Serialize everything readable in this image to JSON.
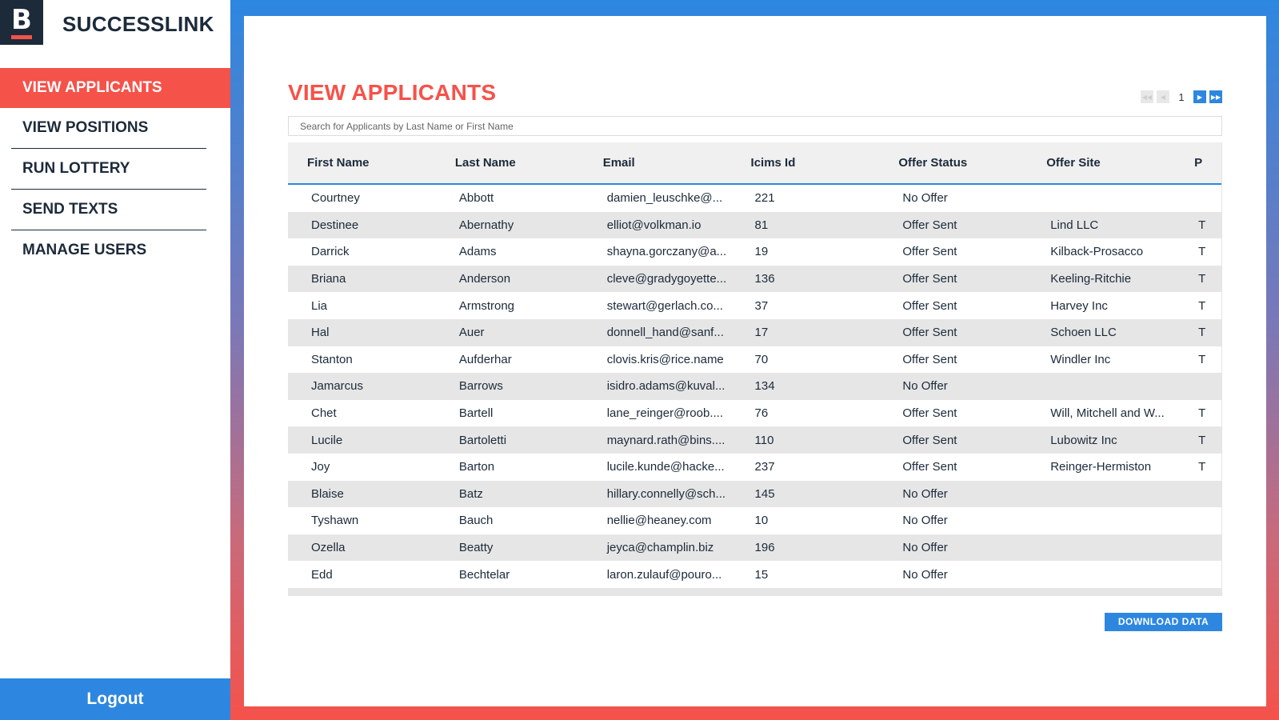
{
  "brand": {
    "logo_letter": "B",
    "name": "SUCCESSLINK"
  },
  "sidebar": {
    "items": [
      {
        "label": "VIEW APPLICANTS",
        "active": true
      },
      {
        "label": "VIEW POSITIONS"
      },
      {
        "label": "RUN LOTTERY"
      },
      {
        "label": "SEND TEXTS"
      },
      {
        "label": "MANAGE USERS"
      }
    ],
    "logout_label": "Logout"
  },
  "main": {
    "title": "VIEW APPLICANTS",
    "pager": {
      "current_page": "1"
    },
    "search": {
      "placeholder": "Search for Applicants by Last Name or First Name",
      "value": ""
    },
    "columns": [
      "First Name",
      "Last Name",
      "Email",
      "Icims Id",
      "Offer Status",
      "Offer Site",
      "P"
    ],
    "rows": [
      [
        "Courtney",
        "Abbott",
        "damien_leuschke@...",
        "221",
        "No Offer",
        "",
        ""
      ],
      [
        "Destinee",
        "Abernathy",
        "elliot@volkman.io",
        "81",
        "Offer Sent",
        "Lind LLC",
        "T"
      ],
      [
        "Darrick",
        "Adams",
        "shayna.gorczany@a...",
        "19",
        "Offer Sent",
        "Kilback-Prosacco",
        "T"
      ],
      [
        "Briana",
        "Anderson",
        "cleve@gradygoyette...",
        "136",
        "Offer Sent",
        "Keeling-Ritchie",
        "T"
      ],
      [
        "Lia",
        "Armstrong",
        "stewart@gerlach.co...",
        "37",
        "Offer Sent",
        "Harvey Inc",
        "T"
      ],
      [
        "Hal",
        "Auer",
        "donnell_hand@sanf...",
        "17",
        "Offer Sent",
        "Schoen LLC",
        "T"
      ],
      [
        "Stanton",
        "Aufderhar",
        "clovis.kris@rice.name",
        "70",
        "Offer Sent",
        "Windler Inc",
        "T"
      ],
      [
        "Jamarcus",
        "Barrows",
        "isidro.adams@kuval...",
        "134",
        "No Offer",
        "",
        ""
      ],
      [
        "Chet",
        "Bartell",
        "lane_reinger@roob....",
        "76",
        "Offer Sent",
        "Will, Mitchell and W...",
        "T"
      ],
      [
        "Lucile",
        "Bartoletti",
        "maynard.rath@bins....",
        "110",
        "Offer Sent",
        "Lubowitz Inc",
        "T"
      ],
      [
        "Joy",
        "Barton",
        "lucile.kunde@hacke...",
        "237",
        "Offer Sent",
        "Reinger-Hermiston",
        "T"
      ],
      [
        "Blaise",
        "Batz",
        "hillary.connelly@sch...",
        "145",
        "No Offer",
        "",
        ""
      ],
      [
        "Tyshawn",
        "Bauch",
        "nellie@heaney.com",
        "10",
        "No Offer",
        "",
        ""
      ],
      [
        "Ozella",
        "Beatty",
        "jeyca@champlin.biz",
        "196",
        "No Offer",
        "",
        ""
      ],
      [
        "Edd",
        "Bechtelar",
        "laron.zulauf@pouro...",
        "15",
        "No Offer",
        "",
        ""
      ],
      [
        "",
        "",
        "",
        "",
        "",
        "",
        ""
      ]
    ],
    "download_label": "DOWNLOAD DATA"
  },
  "colors": {
    "accent_red": "#f5524a",
    "accent_blue": "#2d87e0",
    "navy": "#1c2a3a"
  },
  "icons": [
    "first-page-icon",
    "prev-page-icon",
    "next-page-icon",
    "last-page-icon"
  ]
}
